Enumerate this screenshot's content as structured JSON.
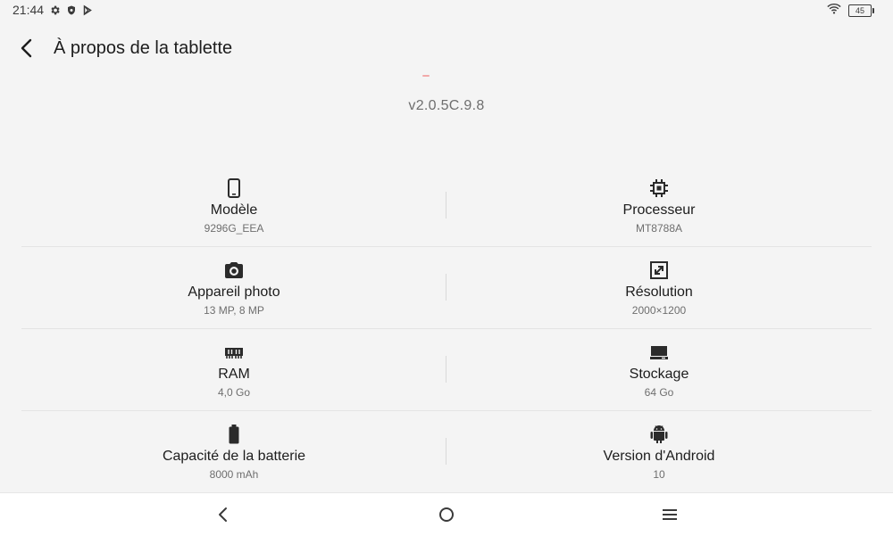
{
  "status": {
    "time": "21:44",
    "left_icons": [
      "gear-icon",
      "shield-icon",
      "play-store-icon"
    ],
    "battery_level": "45",
    "wifi_icon": "wifi-icon"
  },
  "header": {
    "title": "À propos de la tablette",
    "back_icon": "back-arrow-icon"
  },
  "version": "v2.0.5C.9.8",
  "specs": [
    {
      "left": {
        "icon": "phone-icon",
        "label": "Modèle",
        "value": "9296G_EEA"
      },
      "right": {
        "icon": "chip-icon",
        "label": "Processeur",
        "value": "MT8788A"
      }
    },
    {
      "left": {
        "icon": "camera-icon",
        "label": "Appareil photo",
        "value": "13 MP, 8 MP"
      },
      "right": {
        "icon": "resize-icon",
        "label": "Résolution",
        "value": "2000×1200"
      }
    },
    {
      "left": {
        "icon": "memory-icon",
        "label": "RAM",
        "value": "4,0 Go"
      },
      "right": {
        "icon": "storage-icon",
        "label": "Stockage",
        "value": "64 Go"
      }
    },
    {
      "left": {
        "icon": "battery-icon",
        "label": "Capacité de la batterie",
        "value": "8000 mAh"
      },
      "right": {
        "icon": "android-icon",
        "label": "Version d'Android",
        "value": "10"
      }
    }
  ],
  "nav": [
    "back-icon",
    "home-icon",
    "menu-icon"
  ]
}
